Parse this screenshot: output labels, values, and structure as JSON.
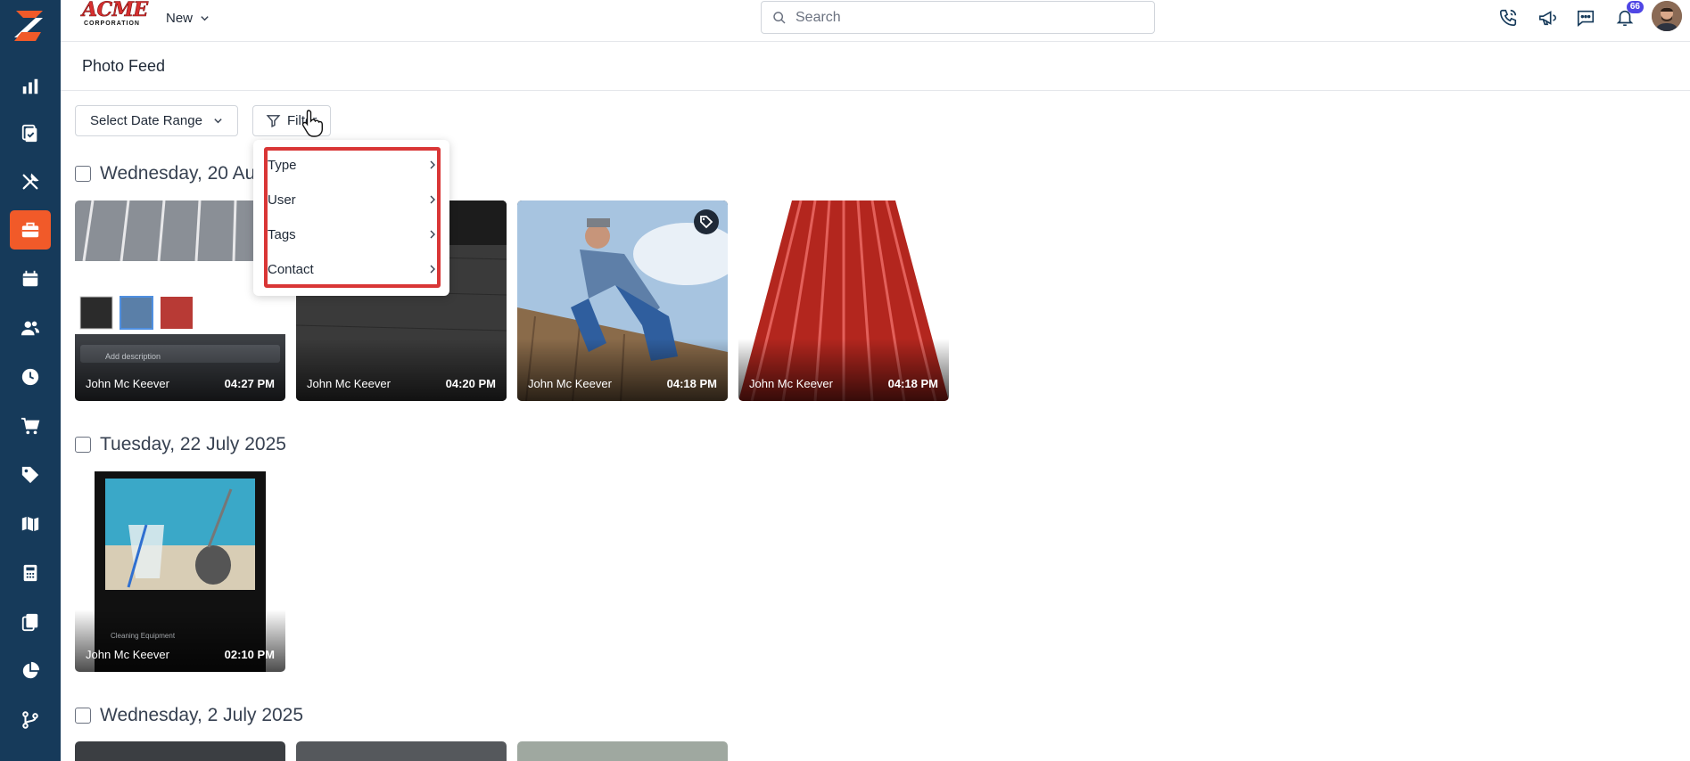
{
  "brand": {
    "name_top": "ACME",
    "name_bottom": "CORPORATION"
  },
  "topbar": {
    "new_label": "New",
    "search_placeholder": "Search",
    "notification_count": "66"
  },
  "sidebar": {
    "items": [
      {
        "icon": "bar-chart-icon"
      },
      {
        "icon": "clipboard-check-icon"
      },
      {
        "icon": "tools-icon"
      },
      {
        "icon": "briefcase-icon",
        "active": true
      },
      {
        "icon": "calendar-icon"
      },
      {
        "icon": "users-icon"
      },
      {
        "icon": "clock-icon"
      },
      {
        "icon": "cart-icon"
      },
      {
        "icon": "tag-icon"
      },
      {
        "icon": "map-icon"
      },
      {
        "icon": "calculator-icon"
      },
      {
        "icon": "documents-icon"
      },
      {
        "icon": "pie-chart-icon"
      },
      {
        "icon": "git-branch-icon"
      }
    ]
  },
  "page": {
    "title": "Photo Feed"
  },
  "controls": {
    "date_range_label": "Select Date Range",
    "filter_label": "Filter"
  },
  "filter_menu": {
    "items": [
      {
        "label": "Type"
      },
      {
        "label": "User"
      },
      {
        "label": "Tags"
      },
      {
        "label": "Contact"
      }
    ]
  },
  "feed": [
    {
      "date": "Wednesday, 20 Au",
      "photos": [
        {
          "author": "John Mc Keever",
          "time": "04:27 PM",
          "description_placeholder": "Add description"
        },
        {
          "author": "John Mc Keever",
          "time": "04:20 PM"
        },
        {
          "author": "John Mc Keever",
          "time": "04:18 PM",
          "tagged": true
        },
        {
          "author": "John Mc Keever",
          "time": "04:18 PM"
        }
      ]
    },
    {
      "date": "Tuesday, 22 July 2025",
      "photos": [
        {
          "author": "John Mc Keever",
          "time": "02:10 PM",
          "caption": "Cleaning Equipment"
        }
      ]
    },
    {
      "date": "Wednesday, 2 July 2025",
      "photos": []
    }
  ],
  "colors": {
    "sidebar": "#163a5a",
    "accent": "#f15a29",
    "highlight": "#d93636",
    "badge": "#4f46e5"
  }
}
